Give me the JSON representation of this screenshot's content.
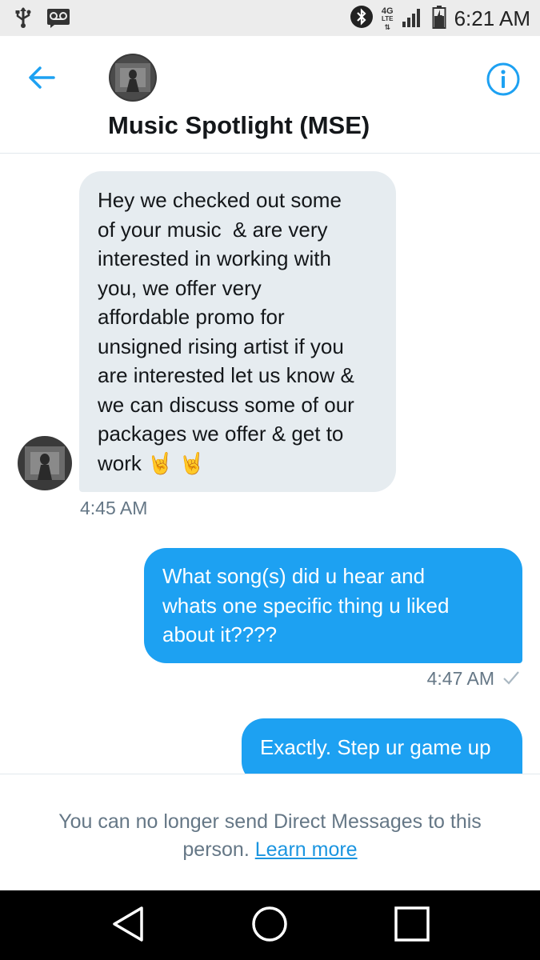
{
  "status_bar": {
    "time": "6:21 AM",
    "network_label": "4G",
    "network_sub": "LTE",
    "icons": [
      "usb-icon",
      "voicemail-icon",
      "bluetooth-icon",
      "signal-icon",
      "battery-icon"
    ]
  },
  "header": {
    "title": "Music Spotlight (MSE)",
    "back_icon": "back-arrow-icon",
    "info_icon": "info-icon"
  },
  "messages": [
    {
      "direction": "incoming",
      "lines": [
        "Hey we checked out some",
        "of your music  & are very",
        "interested in working with",
        "you, we offer very",
        "affordable promo for",
        "unsigned rising artist if you",
        "are interested let us know &",
        "we can discuss some of our",
        "packages we offer & get to",
        "work 🤘 🤘"
      ],
      "time": "4:45 AM"
    },
    {
      "direction": "outgoing",
      "lines": [
        "What song(s) did u hear and",
        "whats one specific thing u liked",
        "about it????"
      ],
      "time": "4:47 AM"
    },
    {
      "direction": "outgoing",
      "lines": [
        "Exactly. Step ur game up"
      ]
    }
  ],
  "footer": {
    "notice": "You can no longer send Direct Messages to this person.",
    "link_label": "Learn more"
  },
  "colors": {
    "accent": "#1da1f2",
    "incoming_bubble": "#e6ecf0",
    "secondary_text": "#657786"
  },
  "nav_bar": {
    "icons": [
      "back-triangle-icon",
      "home-circle-icon",
      "recents-square-icon"
    ]
  }
}
